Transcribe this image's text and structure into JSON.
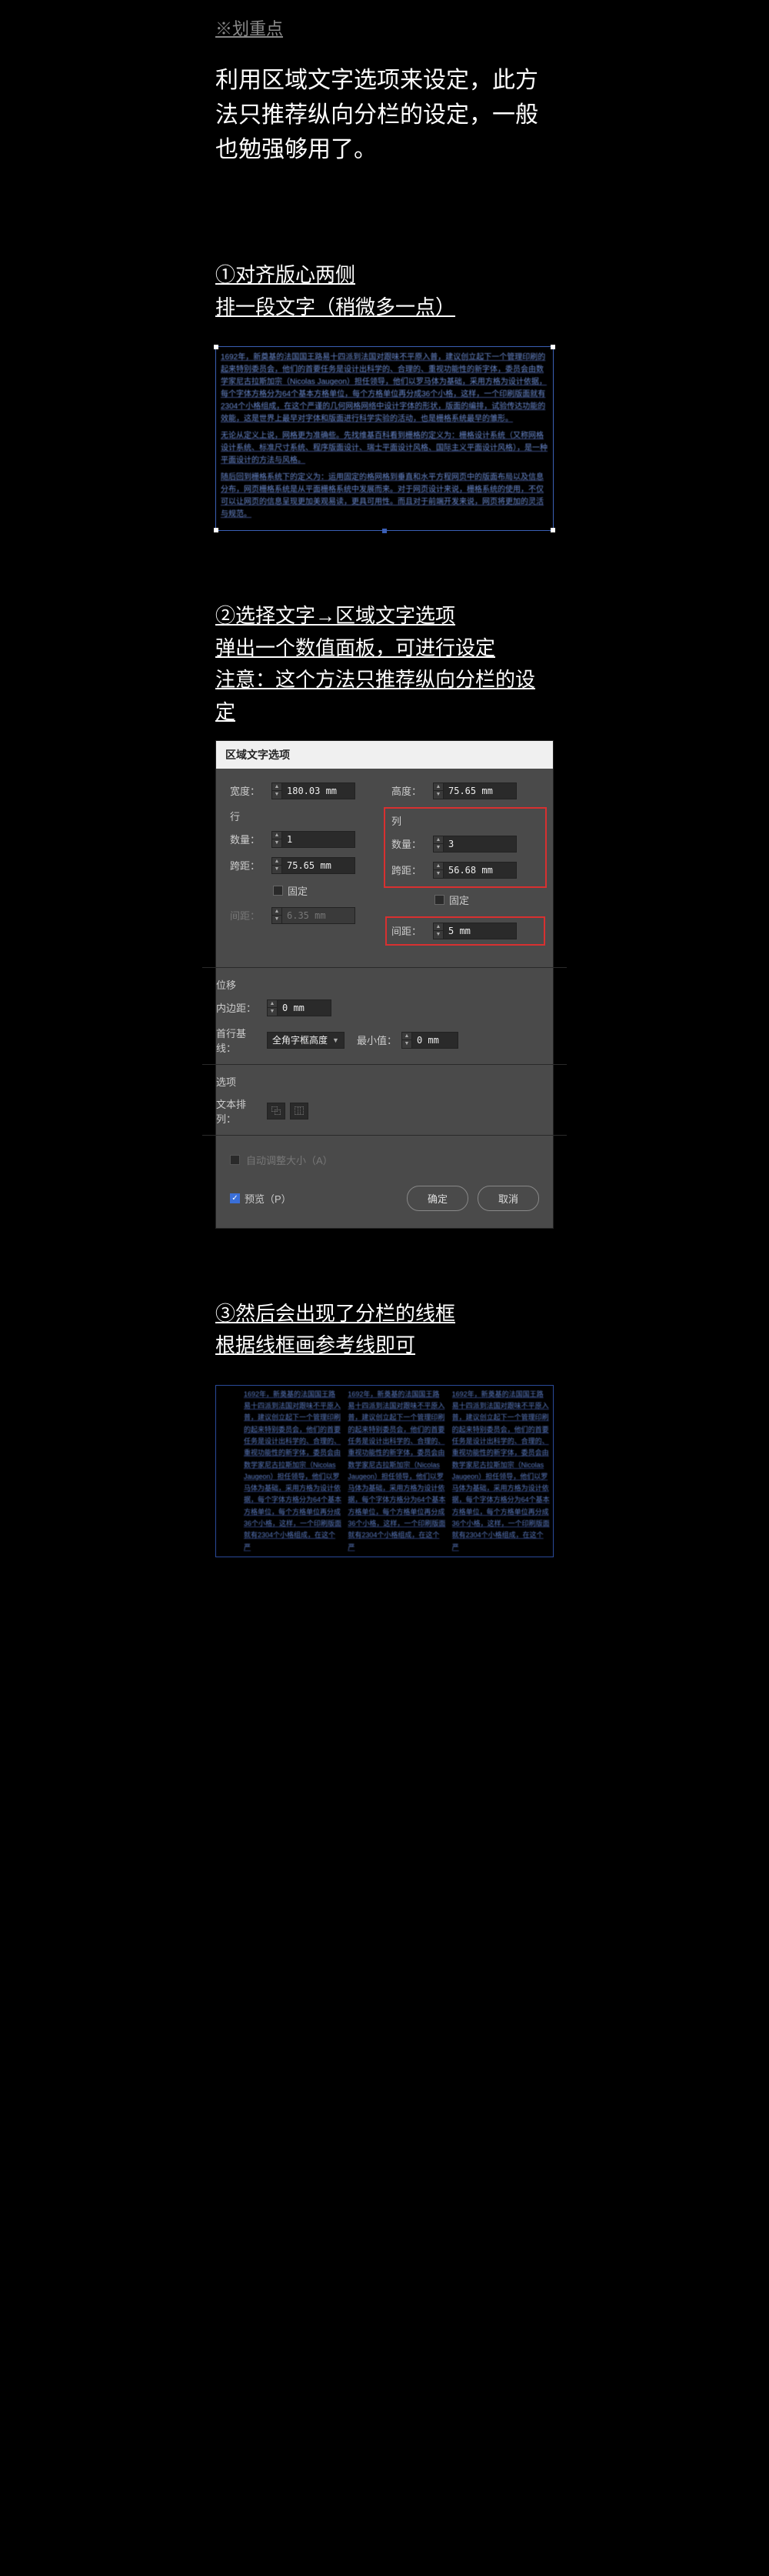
{
  "header": {
    "marker": "※划重点",
    "intro": "利用区域文字选项来设定，此方法只推荐纵向分栏的设定，一般也勉强够用了。"
  },
  "step1": {
    "heading_line1": "①对齐版心两侧",
    "heading_line2": "排一段文字（稍微多一点）",
    "paragraphs": [
      "1692年，新奠基的法国国王路易十四派到法国对跟味不平原入普，建议创立起下一个管理印刷的起来特别委员会，他们的首要任务是设计出科学的、合理的、重视功能性的新字体，委员会由数学家尼古拉斯加宗（Nicolas Jaugeon）担任领导，他们以罗马体为基础，采用方格为设计依据，每个字体方格分为64个基本方格单位，每个方格单位再分成36个小格，这样，一个印刷版面就有2304个小格组成，在这个严谨的几何网格网络中设计字体的形状，版面的编排，试验传达功能的效能，这是世界上最早对字体和版面进行科学实验的活动，也是栅格系统最早的雏形。",
      "无论从定义上说，网格更为准确些。先找维基百科看到栅格的定义为：栅格设计系统（又称网格设计系统、标准尺寸系统、程序版面设计、瑞士平面设计风格、国际主义平面设计风格），是一种平面设计的方法与风格。",
      "随后回到栅格系统下的定义为：运用固定的格网格到垂直和水平方程网页中的版面布局以及信息分布，网页栅格系统是从平面栅格系统中发展而来。对于网页设计来说，栅格系统的使用，不仅可以让网页的信息呈现更加美观易读，更具可用性。而且对于前端开发来说，网页将更加的灵活与规范。"
    ]
  },
  "step2": {
    "heading_line1": "②选择文字→区域文字选项",
    "heading_line2": "弹出一个数值面板，可进行设定",
    "heading_line3": "注意：这个方法只推荐纵向分栏的设定"
  },
  "dialog": {
    "title": "区域文字选项",
    "width_label": "宽度：",
    "width_value": "180.03 mm",
    "height_label": "高度：",
    "height_value": "75.65 mm",
    "rows_section": "行",
    "cols_section": "列",
    "qty_label": "数量：",
    "rows_qty": "1",
    "cols_qty": "3",
    "span_label": "跨距：",
    "rows_span": "75.65 mm",
    "cols_span": "56.68 mm",
    "fixed_label": "固定",
    "gutter_label": "间距：",
    "rows_gutter": "6.35 mm",
    "cols_gutter": "5 mm",
    "offset_section": "位移",
    "inset_label": "内边距：",
    "inset_value": "0 mm",
    "baseline_label": "首行基线：",
    "baseline_value": "全角字框高度",
    "min_label": "最小值：",
    "min_value": "0 mm",
    "options_section": "选项",
    "textflow_label": "文本排列：",
    "autoresize": "自动调整大小（A）",
    "preview": "预览（P）",
    "ok": "确定",
    "cancel": "取消"
  },
  "step3": {
    "heading_line1": "③然后会出现了分栏的线框",
    "heading_line2": "根据线框画参考线即可",
    "col_text": "1692年，新奠基的法国国王路易十四派到法国对跟味不平原入普，建议创立起下一个管理印刷的起来特别委员会，他们的首要任务是设计出科学的、合理的、重视功能性的新字体，委员会由数学家尼古拉斯加宗（Nicolas Jaugeon）担任领导，他们以罗马体为基础，采用方格为设计依据，每个字体方格分为64个基本方格单位，每个方格单位再分成36个小格，这样，一个印刷版面就有2304个小格组成，在这个严"
  }
}
